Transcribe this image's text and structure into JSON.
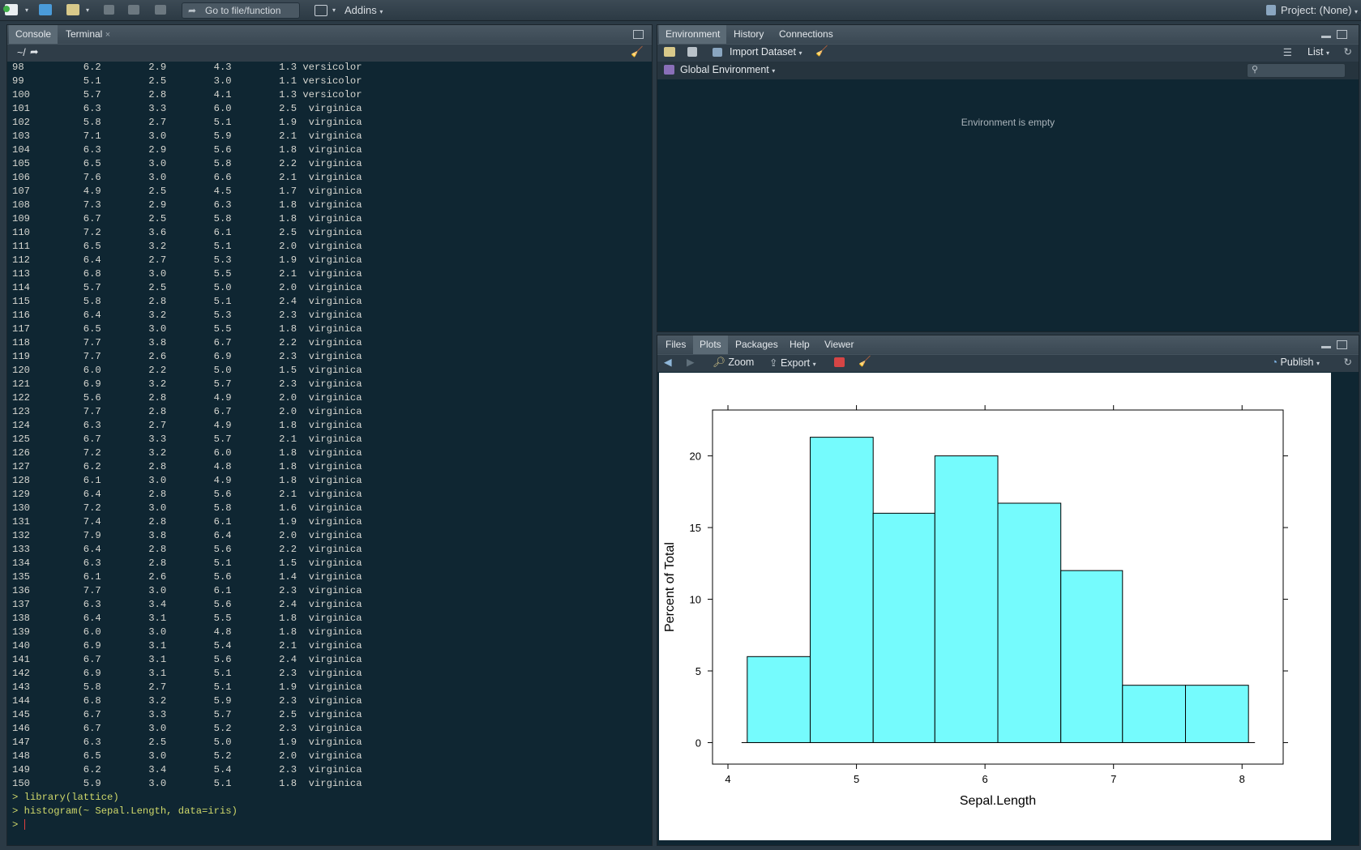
{
  "toolbar": {
    "goto_placeholder": "Go to file/function",
    "addins_label": "Addins",
    "project_label": "Project: (None)"
  },
  "console_pane": {
    "tabs": [
      "Console",
      "Terminal"
    ],
    "path": "~/",
    "rows": [
      [
        "98",
        "6.2",
        "2.9",
        "4.3",
        "1.3",
        "versicolor"
      ],
      [
        "99",
        "5.1",
        "2.5",
        "3.0",
        "1.1",
        "versicolor"
      ],
      [
        "100",
        "5.7",
        "2.8",
        "4.1",
        "1.3",
        "versicolor"
      ],
      [
        "101",
        "6.3",
        "3.3",
        "6.0",
        "2.5",
        "virginica"
      ],
      [
        "102",
        "5.8",
        "2.7",
        "5.1",
        "1.9",
        "virginica"
      ],
      [
        "103",
        "7.1",
        "3.0",
        "5.9",
        "2.1",
        "virginica"
      ],
      [
        "104",
        "6.3",
        "2.9",
        "5.6",
        "1.8",
        "virginica"
      ],
      [
        "105",
        "6.5",
        "3.0",
        "5.8",
        "2.2",
        "virginica"
      ],
      [
        "106",
        "7.6",
        "3.0",
        "6.6",
        "2.1",
        "virginica"
      ],
      [
        "107",
        "4.9",
        "2.5",
        "4.5",
        "1.7",
        "virginica"
      ],
      [
        "108",
        "7.3",
        "2.9",
        "6.3",
        "1.8",
        "virginica"
      ],
      [
        "109",
        "6.7",
        "2.5",
        "5.8",
        "1.8",
        "virginica"
      ],
      [
        "110",
        "7.2",
        "3.6",
        "6.1",
        "2.5",
        "virginica"
      ],
      [
        "111",
        "6.5",
        "3.2",
        "5.1",
        "2.0",
        "virginica"
      ],
      [
        "112",
        "6.4",
        "2.7",
        "5.3",
        "1.9",
        "virginica"
      ],
      [
        "113",
        "6.8",
        "3.0",
        "5.5",
        "2.1",
        "virginica"
      ],
      [
        "114",
        "5.7",
        "2.5",
        "5.0",
        "2.0",
        "virginica"
      ],
      [
        "115",
        "5.8",
        "2.8",
        "5.1",
        "2.4",
        "virginica"
      ],
      [
        "116",
        "6.4",
        "3.2",
        "5.3",
        "2.3",
        "virginica"
      ],
      [
        "117",
        "6.5",
        "3.0",
        "5.5",
        "1.8",
        "virginica"
      ],
      [
        "118",
        "7.7",
        "3.8",
        "6.7",
        "2.2",
        "virginica"
      ],
      [
        "119",
        "7.7",
        "2.6",
        "6.9",
        "2.3",
        "virginica"
      ],
      [
        "120",
        "6.0",
        "2.2",
        "5.0",
        "1.5",
        "virginica"
      ],
      [
        "121",
        "6.9",
        "3.2",
        "5.7",
        "2.3",
        "virginica"
      ],
      [
        "122",
        "5.6",
        "2.8",
        "4.9",
        "2.0",
        "virginica"
      ],
      [
        "123",
        "7.7",
        "2.8",
        "6.7",
        "2.0",
        "virginica"
      ],
      [
        "124",
        "6.3",
        "2.7",
        "4.9",
        "1.8",
        "virginica"
      ],
      [
        "125",
        "6.7",
        "3.3",
        "5.7",
        "2.1",
        "virginica"
      ],
      [
        "126",
        "7.2",
        "3.2",
        "6.0",
        "1.8",
        "virginica"
      ],
      [
        "127",
        "6.2",
        "2.8",
        "4.8",
        "1.8",
        "virginica"
      ],
      [
        "128",
        "6.1",
        "3.0",
        "4.9",
        "1.8",
        "virginica"
      ],
      [
        "129",
        "6.4",
        "2.8",
        "5.6",
        "2.1",
        "virginica"
      ],
      [
        "130",
        "7.2",
        "3.0",
        "5.8",
        "1.6",
        "virginica"
      ],
      [
        "131",
        "7.4",
        "2.8",
        "6.1",
        "1.9",
        "virginica"
      ],
      [
        "132",
        "7.9",
        "3.8",
        "6.4",
        "2.0",
        "virginica"
      ],
      [
        "133",
        "6.4",
        "2.8",
        "5.6",
        "2.2",
        "virginica"
      ],
      [
        "134",
        "6.3",
        "2.8",
        "5.1",
        "1.5",
        "virginica"
      ],
      [
        "135",
        "6.1",
        "2.6",
        "5.6",
        "1.4",
        "virginica"
      ],
      [
        "136",
        "7.7",
        "3.0",
        "6.1",
        "2.3",
        "virginica"
      ],
      [
        "137",
        "6.3",
        "3.4",
        "5.6",
        "2.4",
        "virginica"
      ],
      [
        "138",
        "6.4",
        "3.1",
        "5.5",
        "1.8",
        "virginica"
      ],
      [
        "139",
        "6.0",
        "3.0",
        "4.8",
        "1.8",
        "virginica"
      ],
      [
        "140",
        "6.9",
        "3.1",
        "5.4",
        "2.1",
        "virginica"
      ],
      [
        "141",
        "6.7",
        "3.1",
        "5.6",
        "2.4",
        "virginica"
      ],
      [
        "142",
        "6.9",
        "3.1",
        "5.1",
        "2.3",
        "virginica"
      ],
      [
        "143",
        "5.8",
        "2.7",
        "5.1",
        "1.9",
        "virginica"
      ],
      [
        "144",
        "6.8",
        "3.2",
        "5.9",
        "2.3",
        "virginica"
      ],
      [
        "145",
        "6.7",
        "3.3",
        "5.7",
        "2.5",
        "virginica"
      ],
      [
        "146",
        "6.7",
        "3.0",
        "5.2",
        "2.3",
        "virginica"
      ],
      [
        "147",
        "6.3",
        "2.5",
        "5.0",
        "1.9",
        "virginica"
      ],
      [
        "148",
        "6.5",
        "3.0",
        "5.2",
        "2.0",
        "virginica"
      ],
      [
        "149",
        "6.2",
        "3.4",
        "5.4",
        "2.3",
        "virginica"
      ],
      [
        "150",
        "5.9",
        "3.0",
        "5.1",
        "1.8",
        "virginica"
      ]
    ],
    "commands": [
      "> library(lattice)",
      "> histogram(~ Sepal.Length, data=iris)",
      "> "
    ]
  },
  "env_pane": {
    "tabs": [
      "Environment",
      "History",
      "Connections"
    ],
    "import_label": "Import Dataset",
    "list_label": "List",
    "global_env_label": "Global Environment",
    "empty_message": "Environment is empty"
  },
  "files_pane": {
    "tabs": [
      "Files",
      "Plots",
      "Packages",
      "Help",
      "Viewer"
    ],
    "zoom_label": "Zoom",
    "export_label": "Export",
    "publish_label": "Publish"
  },
  "chart_data": {
    "type": "bar",
    "title": "",
    "xlabel": "Sepal.Length",
    "ylabel": "Percent of Total",
    "bins": [
      {
        "x0": 4.15,
        "x1": 4.64,
        "value": 6.0
      },
      {
        "x0": 4.64,
        "x1": 5.13,
        "value": 21.3
      },
      {
        "x0": 5.13,
        "x1": 5.61,
        "value": 16.0
      },
      {
        "x0": 5.61,
        "x1": 6.1,
        "value": 20.0
      },
      {
        "x0": 6.1,
        "x1": 6.59,
        "value": 16.7
      },
      {
        "x0": 6.59,
        "x1": 7.07,
        "value": 12.0
      },
      {
        "x0": 7.07,
        "x1": 7.56,
        "value": 4.0
      },
      {
        "x0": 7.56,
        "x1": 8.05,
        "value": 4.0
      }
    ],
    "xticks": [
      4,
      5,
      6,
      7,
      8
    ],
    "yticks": [
      0,
      5,
      10,
      15,
      20
    ],
    "xlim": [
      3.88,
      8.32
    ],
    "ylim": [
      -1.5,
      23.2
    ],
    "fill_color": "#75fbfd",
    "grid": false
  },
  "colors": {
    "console_bg": "#0f2632",
    "command_text": "#cfd86a",
    "bar_fill": "#75fbfd"
  }
}
